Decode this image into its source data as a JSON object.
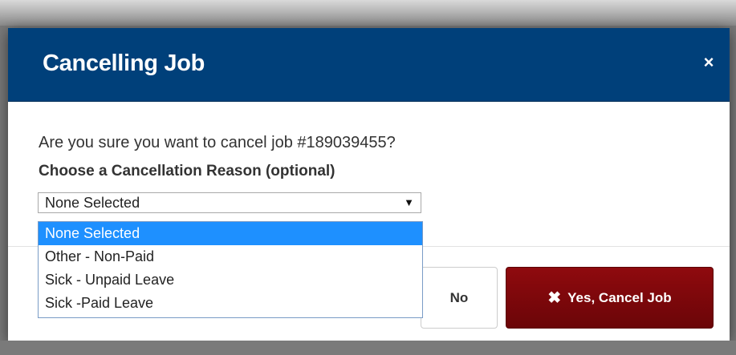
{
  "modal": {
    "title": "Cancelling Job",
    "close_icon": "close-icon",
    "close_glyph": "×"
  },
  "body": {
    "question": "Are you sure you want to cancel job #189039455?",
    "reason_label": "Choose a Cancellation Reason (optional)",
    "select_value": "None Selected",
    "select_arrow": "▼",
    "options": [
      {
        "label": "None Selected",
        "selected": true
      },
      {
        "label": "Other - Non-Paid",
        "selected": false
      },
      {
        "label": "Sick - Unpaid Leave",
        "selected": false
      },
      {
        "label": "Sick -Paid Leave",
        "selected": false
      }
    ]
  },
  "footer": {
    "no_label": "No",
    "yes_label": "Yes, Cancel Job",
    "yes_icon": "x-icon",
    "yes_glyph": "✖"
  },
  "colors": {
    "header": "#00407a",
    "danger": "#8f0a0e",
    "highlight": "#1e90ff"
  }
}
